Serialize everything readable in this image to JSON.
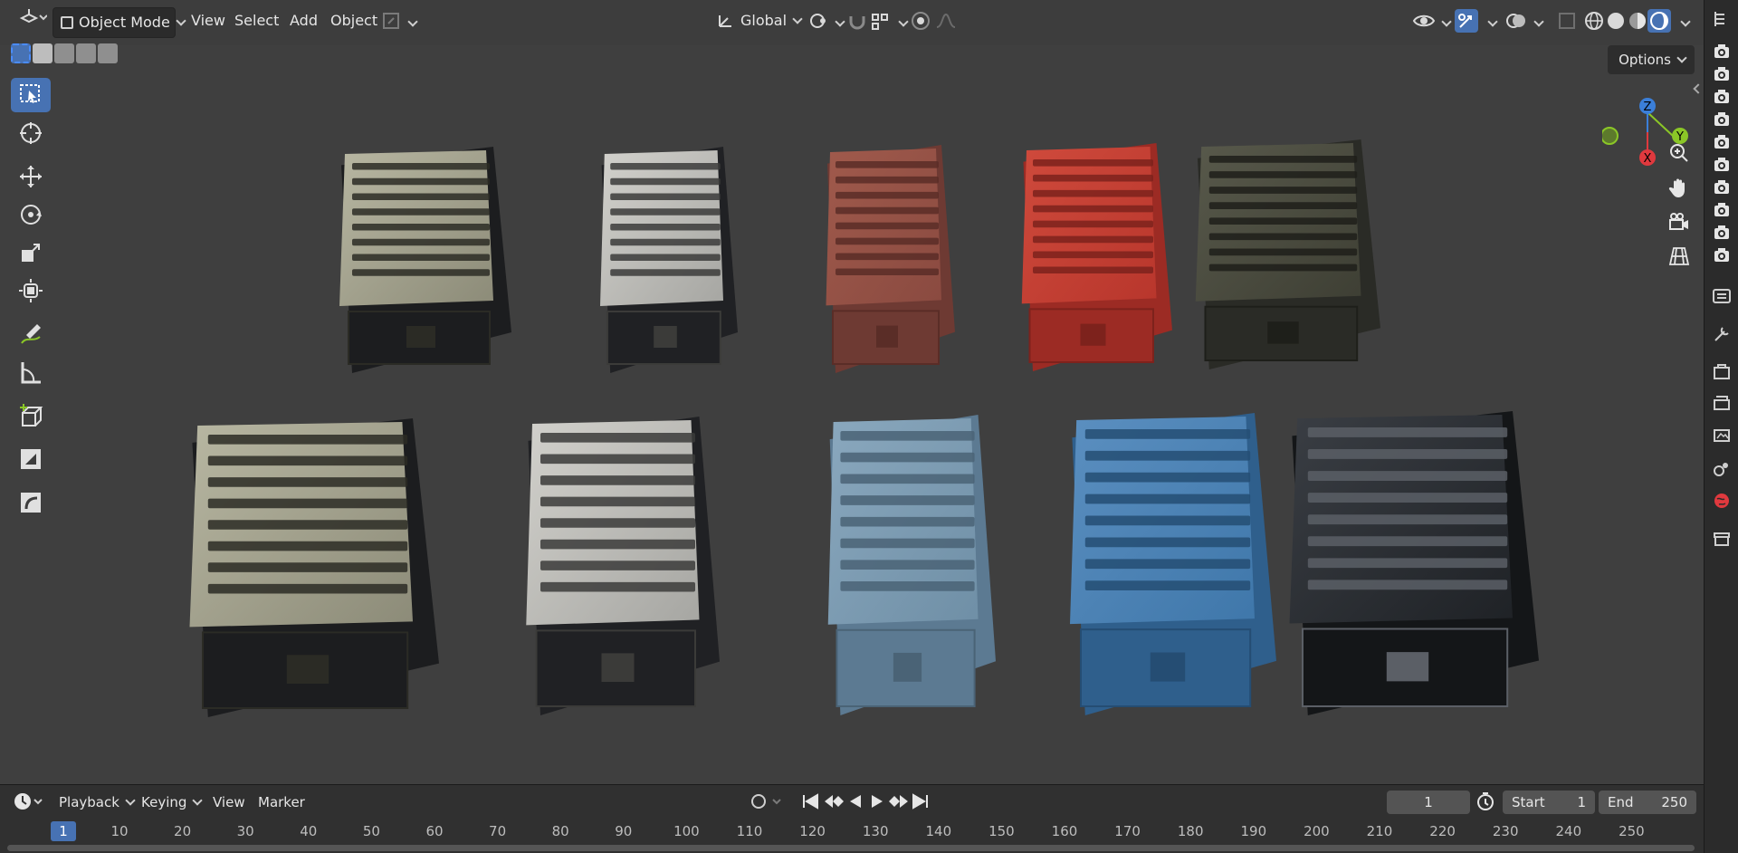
{
  "header": {
    "editor_type_icon": "3d-viewport-icon",
    "mode_label": "Object Mode",
    "menus": [
      "View",
      "Select",
      "Add",
      "Object"
    ],
    "transform_orientation": "Global",
    "options_label": "Options"
  },
  "viewport": {
    "gizmo_axes": {
      "x": "X",
      "y": "Y",
      "z": "Z"
    },
    "crates": [
      {
        "row": 1,
        "col": 1,
        "finish": "worn silver metal"
      },
      {
        "row": 1,
        "col": 2,
        "finish": "silver metal"
      },
      {
        "row": 1,
        "col": 3,
        "finish": "rusted red"
      },
      {
        "row": 1,
        "col": 4,
        "finish": "painted red"
      },
      {
        "row": 1,
        "col": 5,
        "finish": "dark weathered metal"
      },
      {
        "row": 2,
        "col": 1,
        "finish": "worn silver metal"
      },
      {
        "row": 2,
        "col": 2,
        "finish": "silver metal"
      },
      {
        "row": 2,
        "col": 3,
        "finish": "weathered blue"
      },
      {
        "row": 2,
        "col": 4,
        "finish": "painted blue"
      },
      {
        "row": 2,
        "col": 5,
        "finish": "black steel"
      }
    ]
  },
  "timeline": {
    "menus": [
      "Playback",
      "Keying",
      "View",
      "Marker"
    ],
    "current_frame": "1",
    "start_label": "Start",
    "start_value": "1",
    "end_label": "End",
    "end_value": "250",
    "ruler_ticks": [
      "10",
      "20",
      "30",
      "40",
      "50",
      "60",
      "70",
      "80",
      "90",
      "100",
      "110",
      "120",
      "130",
      "140",
      "150",
      "160",
      "170",
      "180",
      "190",
      "200",
      "210",
      "220",
      "230",
      "240",
      "250"
    ],
    "playhead_label": "1"
  },
  "colors": {
    "accent": "#4772b3",
    "viewport_bg": "#3f3f3f",
    "axis_x": "#e0393e",
    "axis_y": "#8bc727",
    "axis_z": "#3b7fd9"
  }
}
